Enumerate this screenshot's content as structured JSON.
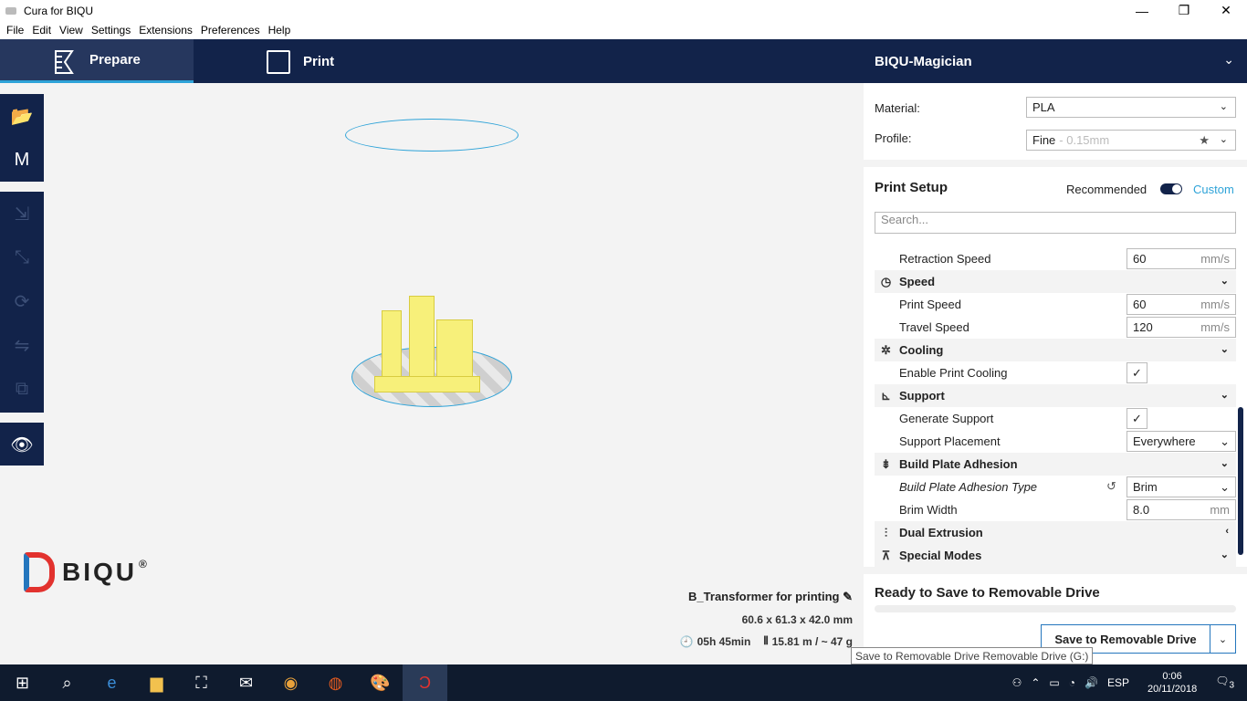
{
  "window": {
    "title": "Cura for BIQU",
    "min": "—",
    "restore": "❐",
    "close": "✕"
  },
  "menu": [
    "File",
    "Edit",
    "View",
    "Settings",
    "Extensions",
    "Preferences",
    "Help"
  ],
  "tabs": {
    "prepare": "Prepare",
    "print": "Print"
  },
  "machine": {
    "name": "BIQU-Magician"
  },
  "brand": {
    "name": "BIQU",
    "mark": "®"
  },
  "object": {
    "name": "B_Transformer for printing",
    "dims": "60.6 x 61.3 x 42.0 mm",
    "time": "05h 45min",
    "material": "15.81 m / ~ 47 g"
  },
  "material": {
    "label": "Material:",
    "value": "PLA"
  },
  "profile": {
    "label": "Profile:",
    "value": "Fine",
    "hint": "- 0.15mm"
  },
  "setup": {
    "title": "Print Setup",
    "recommended": "Recommended",
    "custom": "Custom",
    "search_placeholder": "Search..."
  },
  "settings": {
    "retraction_speed": {
      "label": "Retraction Speed",
      "value": "60",
      "unit": "mm/s"
    },
    "speed": "Speed",
    "print_speed": {
      "label": "Print Speed",
      "value": "60",
      "unit": "mm/s"
    },
    "travel_speed": {
      "label": "Travel Speed",
      "value": "120",
      "unit": "mm/s"
    },
    "cooling": "Cooling",
    "enable_cooling": {
      "label": "Enable Print Cooling",
      "value": "✓"
    },
    "support": "Support",
    "generate_support": {
      "label": "Generate Support",
      "value": "✓"
    },
    "support_placement": {
      "label": "Support Placement",
      "value": "Everywhere"
    },
    "adhesion": "Build Plate Adhesion",
    "adhesion_type": {
      "label": "Build Plate Adhesion Type",
      "value": "Brim"
    },
    "brim_width": {
      "label": "Brim Width",
      "value": "8.0",
      "unit": "mm"
    },
    "dual": "Dual Extrusion",
    "special": "Special Modes"
  },
  "output": {
    "ready": "Ready to Save to Removable Drive",
    "button": "Save to Removable Drive",
    "tooltip": "Save to Removable Drive Removable Drive (G:)"
  },
  "taskbar": {
    "lang": "ESP",
    "time": "0:06",
    "date": "20/11/2018",
    "notifications": "3"
  }
}
